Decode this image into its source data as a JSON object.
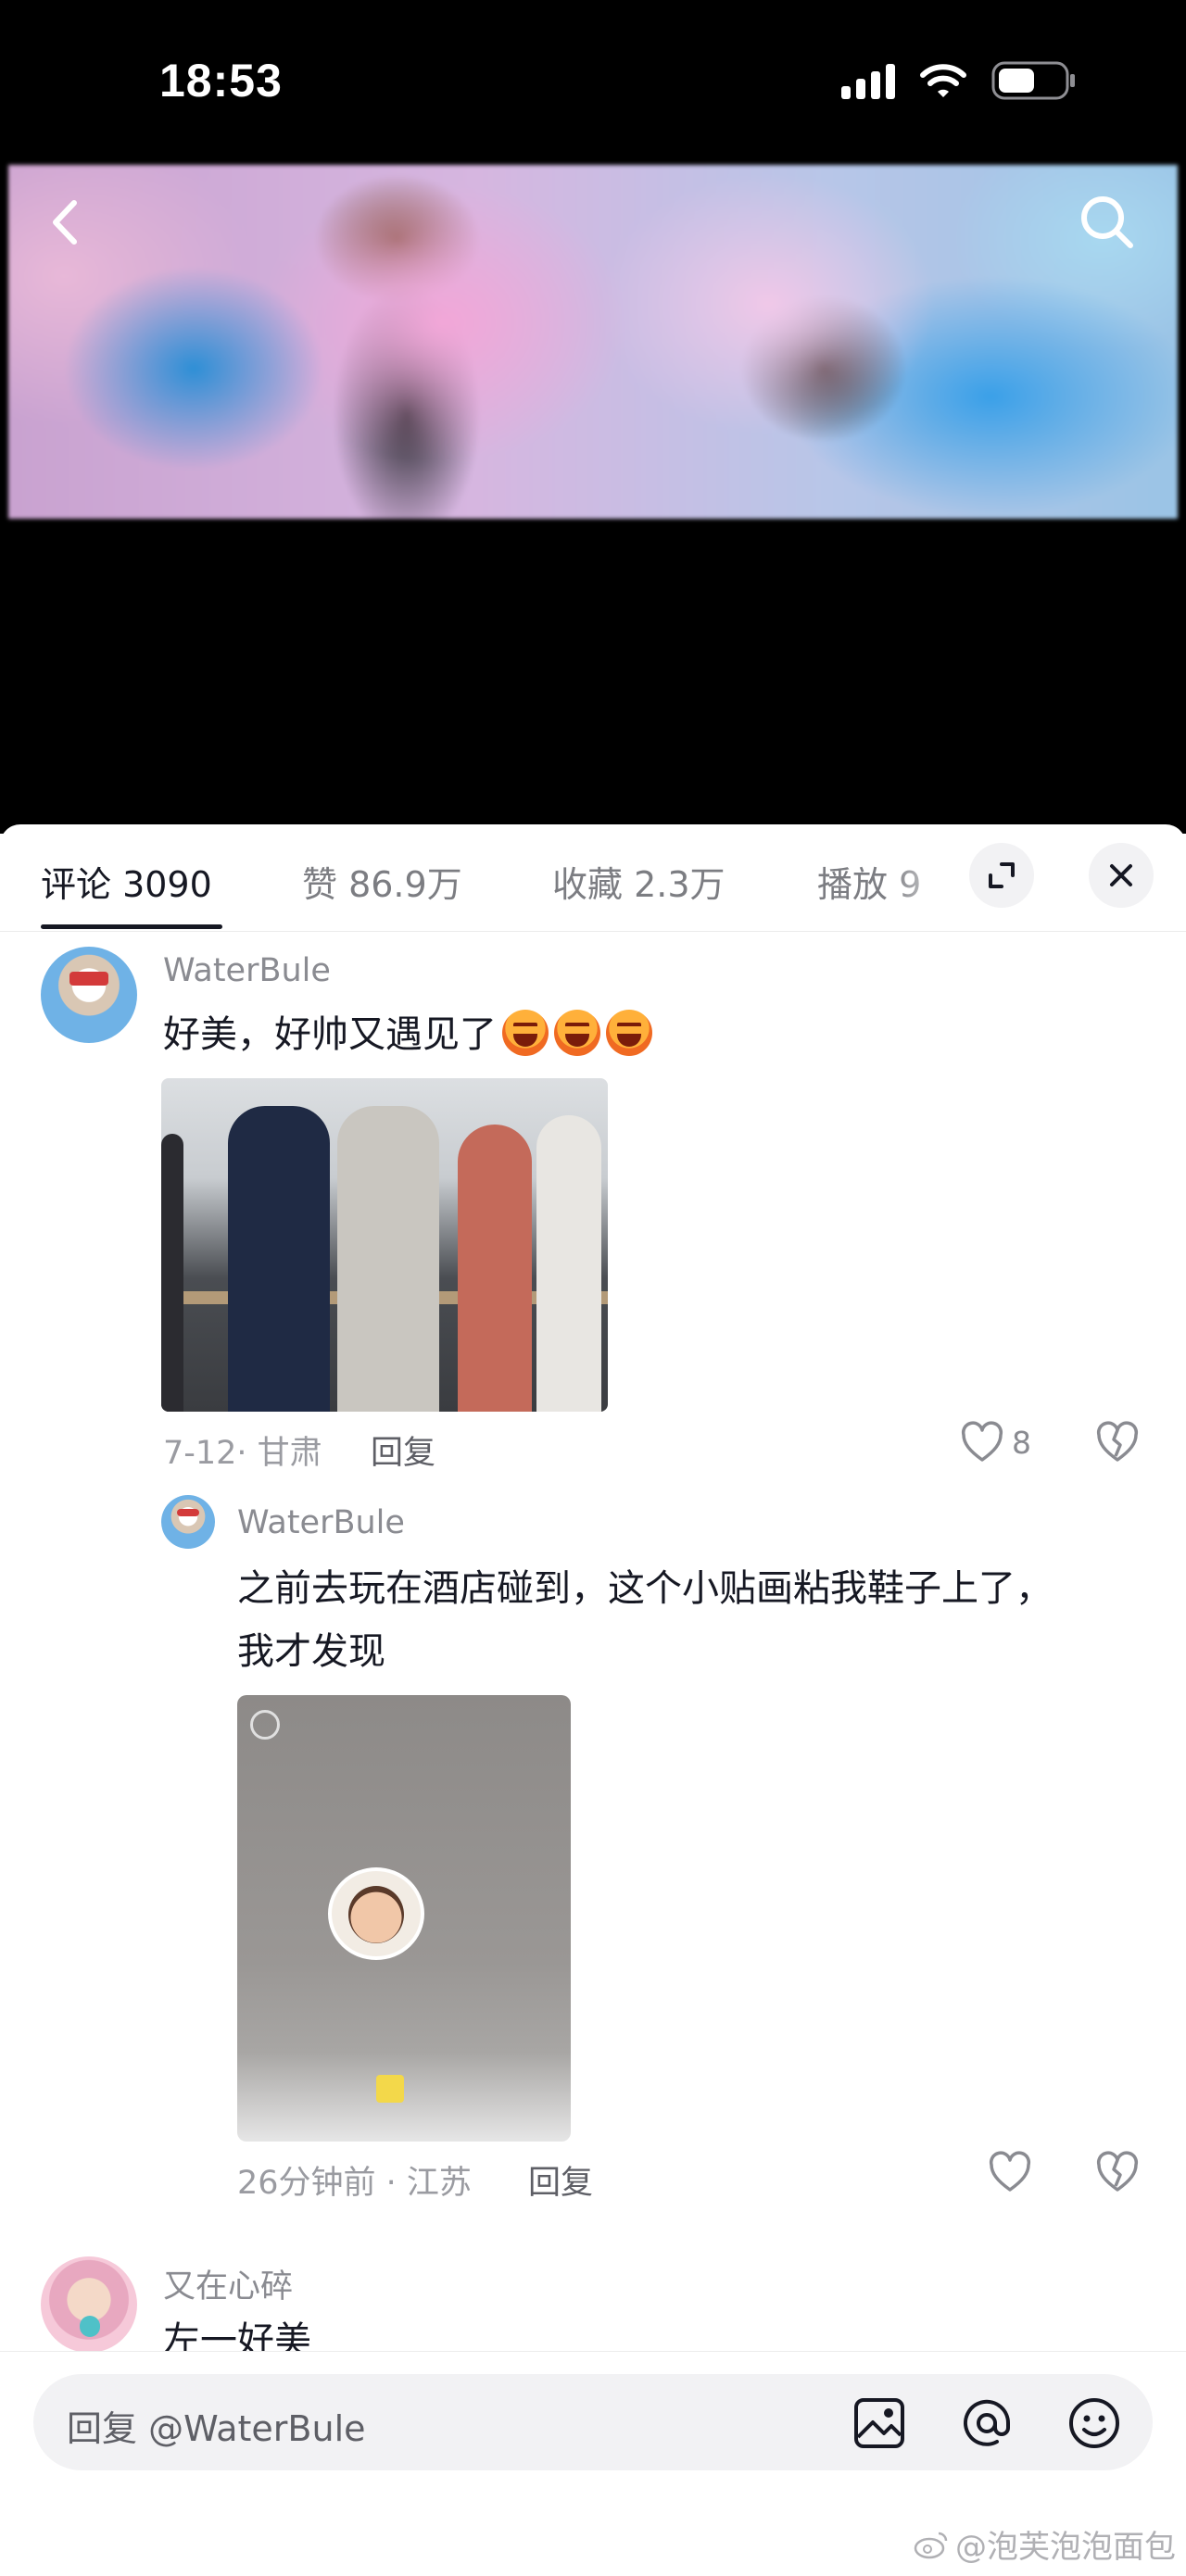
{
  "status_bar": {
    "time": "18:53",
    "icons": [
      "signal-icon",
      "wifi-icon",
      "battery-icon"
    ]
  },
  "video": {
    "icons": [
      "back-icon",
      "search-icon"
    ]
  },
  "tabs": [
    {
      "label": "评论 3090",
      "active": true
    },
    {
      "label": "赞 86.9万",
      "active": false
    },
    {
      "label": "收藏 2.3万",
      "active": false
    },
    {
      "label": "播放 9",
      "active": false
    }
  ],
  "tab_actions": [
    "expand-icon",
    "close-icon"
  ],
  "comments": [
    {
      "username": "WaterBule",
      "text": "好美，好帅又遇见了",
      "emoji_count": 3,
      "date_location": "7-12· 甘肃",
      "reply_label": "回复",
      "likes": "8",
      "replies": [
        {
          "username": "WaterBule",
          "text_line1": "之前去玩在酒店碰到，这个小贴画粘我鞋子上了，",
          "text_line2": "我才发现",
          "date_location": "26分钟前 · 江苏",
          "reply_label": "回复"
        }
      ]
    },
    {
      "username": "又在心碎",
      "text": "左一好美"
    }
  ],
  "reply_box": {
    "placeholder": "回复 @WaterBule",
    "icons": [
      "image-icon",
      "at-icon",
      "emoji-icon"
    ]
  },
  "watermark": "@泡芙泡泡面包",
  "colors": {
    "sheet_bg": "#ffffff",
    "top_bg": "#000000",
    "primary_text": "#161823",
    "muted_text": "#8a8b91"
  }
}
